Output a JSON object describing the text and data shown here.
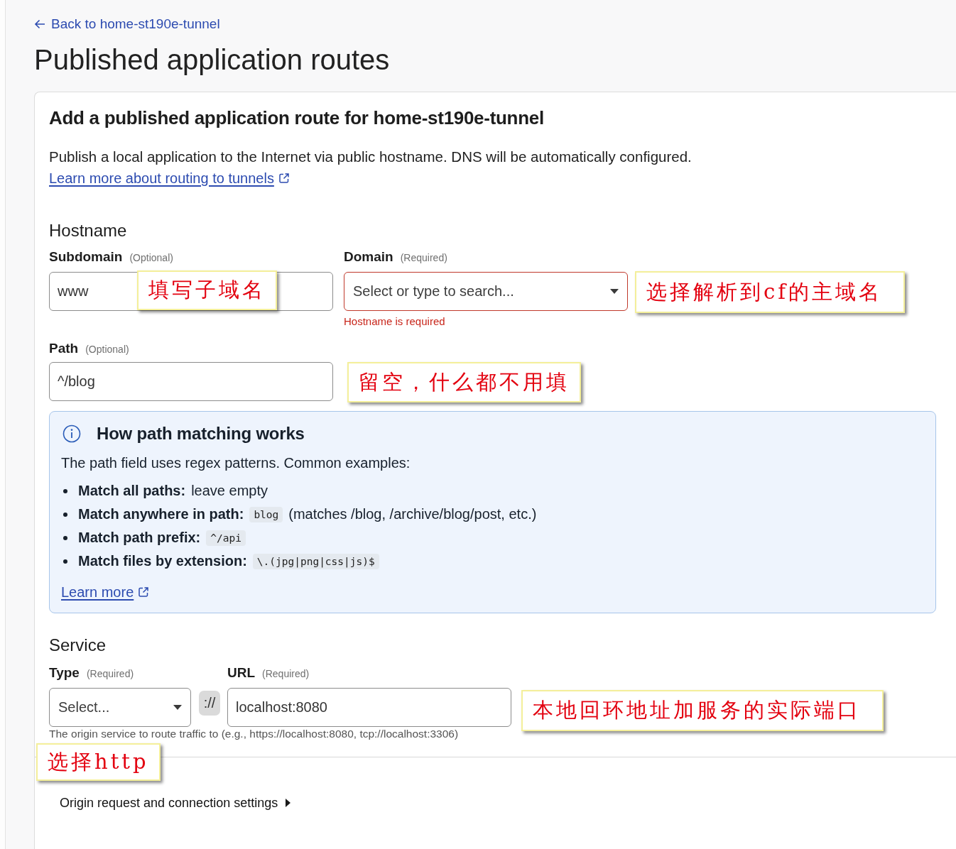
{
  "back_link": {
    "label": "Back to home-st190e-tunnel"
  },
  "title": "Published application routes",
  "card": {
    "heading": "Add a published application route for home-st190e-tunnel",
    "description": "Publish a local application to the Internet via public hostname. DNS will be automatically configured.",
    "learn_link": "Learn more about routing to tunnels",
    "hostname": {
      "heading": "Hostname",
      "subdomain": {
        "label": "Subdomain",
        "hint": "(Optional)",
        "value": "www",
        "note": "填写子域名"
      },
      "domain": {
        "label": "Domain",
        "hint": "(Required)",
        "placeholder": "Select or type to search...",
        "invalid": true,
        "error": "Hostname is required",
        "note": "选择解析到cf的主域名"
      }
    },
    "path": {
      "label": "Path",
      "hint": "(Optional)",
      "value": "^/blog",
      "note": "留空，什么都不用填"
    },
    "info": {
      "title": "How path matching works",
      "intro": "The path field uses regex patterns. Common examples:",
      "examples": [
        {
          "term": "Match all paths:",
          "text": "leave empty"
        },
        {
          "term": "Match anywhere in path:",
          "code": "blog",
          "text": "(matches /blog, /archive/blog/post, etc.)"
        },
        {
          "term": "Match path prefix:",
          "code": "^/api"
        },
        {
          "term": "Match files by extension:",
          "code": "\\.(jpg|png|css|js)$"
        }
      ],
      "link": "Learn more"
    },
    "service": {
      "heading": "Service",
      "type": {
        "label": "Type",
        "hint": "(Required)",
        "placeholder": "Select...",
        "note": "选择http"
      },
      "separator": "://",
      "url": {
        "label": "URL",
        "hint": "(Required)",
        "value": "localhost:8080",
        "note": "本地回环地址加服务的实际端口"
      },
      "help": "The origin service to route traffic to (e.g., https://localhost:8080, tcp://localhost:3306)"
    },
    "settings_toggle": {
      "label": "Origin request and connection settings",
      "expanded": false
    }
  }
}
